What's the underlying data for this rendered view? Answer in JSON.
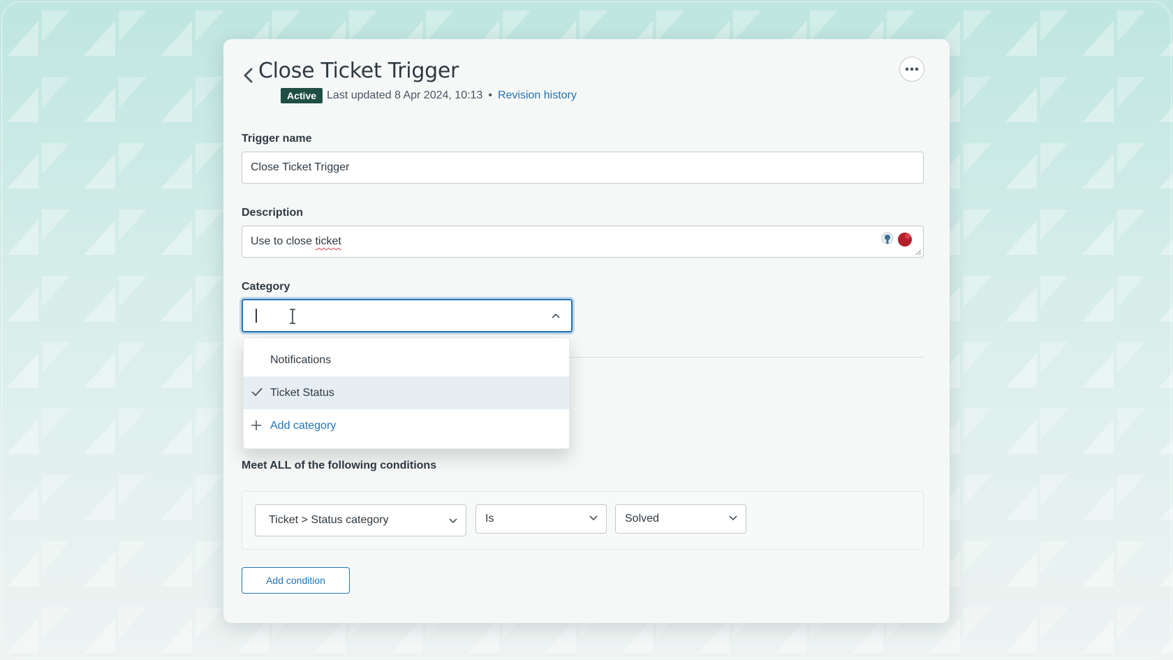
{
  "header": {
    "title": "Close Ticket Trigger",
    "status_badge": "Active",
    "last_updated": "Last updated 8 Apr 2024, 10:13",
    "separator": "•",
    "revision_link": "Revision history"
  },
  "form": {
    "trigger_name_label": "Trigger name",
    "trigger_name_value": "Close Ticket Trigger",
    "description_label": "Description",
    "description_prefix": "Use to close ",
    "description_misspelled": "ticket",
    "category_label": "Category",
    "category_value": ""
  },
  "category_dropdown": {
    "options": [
      {
        "label": "Notifications",
        "selected": false
      },
      {
        "label": "Ticket Status",
        "selected": true
      }
    ],
    "add_label": "Add category"
  },
  "conditions": {
    "heading": "Meet ALL of the following conditions",
    "row": {
      "field": "Ticket > Status category",
      "operator": "Is",
      "value": "Solved"
    },
    "add_button": "Add condition"
  },
  "icons": {
    "back": "chevron-left-icon",
    "more": "ellipsis-icon",
    "grammar_extension": "bulb-icon",
    "spell_extension": "spellcheck-icon",
    "dropdown_open": "chevron-up-icon",
    "select": "chevron-down-icon",
    "check": "check-icon",
    "add": "plus-icon",
    "cursor": "text-cursor-icon"
  },
  "colors": {
    "accent": "#1f73b7",
    "badge_bg": "#1f4e44",
    "text": "#2f3941",
    "background": "#bfe6e0"
  }
}
